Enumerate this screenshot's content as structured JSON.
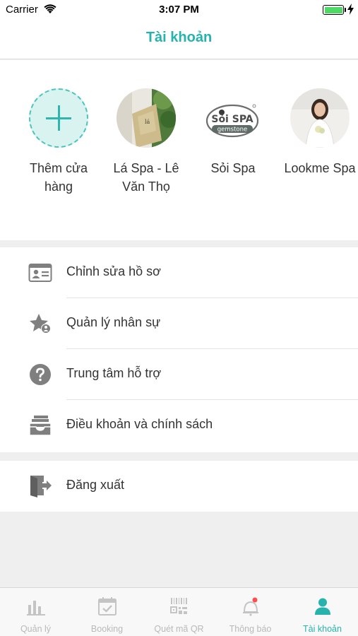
{
  "status_bar": {
    "carrier": "Carrier",
    "time": "3:07 PM"
  },
  "nav": {
    "title": "Tài khoản"
  },
  "stores": [
    {
      "label": "Thêm cửa hàng",
      "icon": "plus-icon"
    },
    {
      "label": "Lá Spa - Lê Văn Thọ",
      "icon": "store-photo"
    },
    {
      "label": "Sỏi Spa",
      "icon": "soi-spa-logo",
      "logo_text_top": "Sỏi SPA",
      "logo_text_bottom": "gemstone"
    },
    {
      "label": "Lookme Spa",
      "icon": "store-photo"
    }
  ],
  "menu": [
    {
      "label": "Chỉnh sửa hồ sơ",
      "icon": "profile-card-icon"
    },
    {
      "label": "Quản lý nhân sự",
      "icon": "star-person-icon"
    },
    {
      "label": "Trung tâm hỗ trợ",
      "icon": "help-icon"
    },
    {
      "label": "Điều khoản và chính sách",
      "icon": "inbox-tray-icon"
    }
  ],
  "logout": {
    "label": "Đăng xuất",
    "icon": "logout-door-icon"
  },
  "tabs": [
    {
      "label": "Quản lý",
      "icon": "bar-chart-icon",
      "active": false
    },
    {
      "label": "Booking",
      "icon": "calendar-check-icon",
      "active": false
    },
    {
      "label": "Quét mã QR",
      "icon": "qr-scan-icon",
      "active": false
    },
    {
      "label": "Thông báo",
      "icon": "bell-icon",
      "active": false
    },
    {
      "label": "Tài khoản",
      "icon": "person-icon",
      "active": true
    }
  ],
  "colors": {
    "accent": "#26b3ae",
    "inactive_tab": "#b9b9b9",
    "badge": "#ff4d4d"
  }
}
